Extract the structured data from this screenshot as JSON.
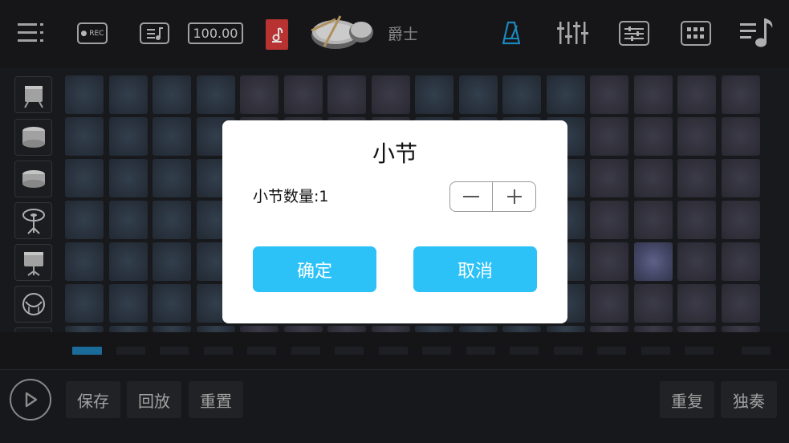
{
  "toolbar": {
    "menu_icon": "menu-icon",
    "rec_label": "● REC",
    "tempo": "100.00",
    "kit_name": "爵士",
    "icons": [
      "menu-icon",
      "record-icon",
      "song-list-icon",
      "tempo-display",
      "music-note-icon",
      "drum-kit-icon",
      "metronome-icon",
      "mixer-icon",
      "settings-sliders-icon",
      "pad-grid-icon",
      "playlist-icon"
    ]
  },
  "colors": {
    "accent": "#2cc2f7",
    "note_icon_bg": "#d23a3a",
    "metronome": "#1e9bd6",
    "active_step": "#1f7ab0"
  },
  "sidebar": {
    "instruments": [
      "kick-drum-icon",
      "snare-drum-icon",
      "tom-drum-icon",
      "hihat-icon",
      "floor-tom-icon",
      "cymbal-icon"
    ]
  },
  "grid": {
    "active_pad_row": 5,
    "active_pad_col": 14
  },
  "steps": {
    "active_index": 0
  },
  "bottom": {
    "save": "保存",
    "playback": "回放",
    "reset": "重置",
    "repeat": "重复",
    "solo": "独奏"
  },
  "dialog": {
    "title": "小节",
    "count_label": "小节数量:1",
    "minus": "−",
    "plus": "+",
    "confirm": "确定",
    "cancel": "取消"
  }
}
